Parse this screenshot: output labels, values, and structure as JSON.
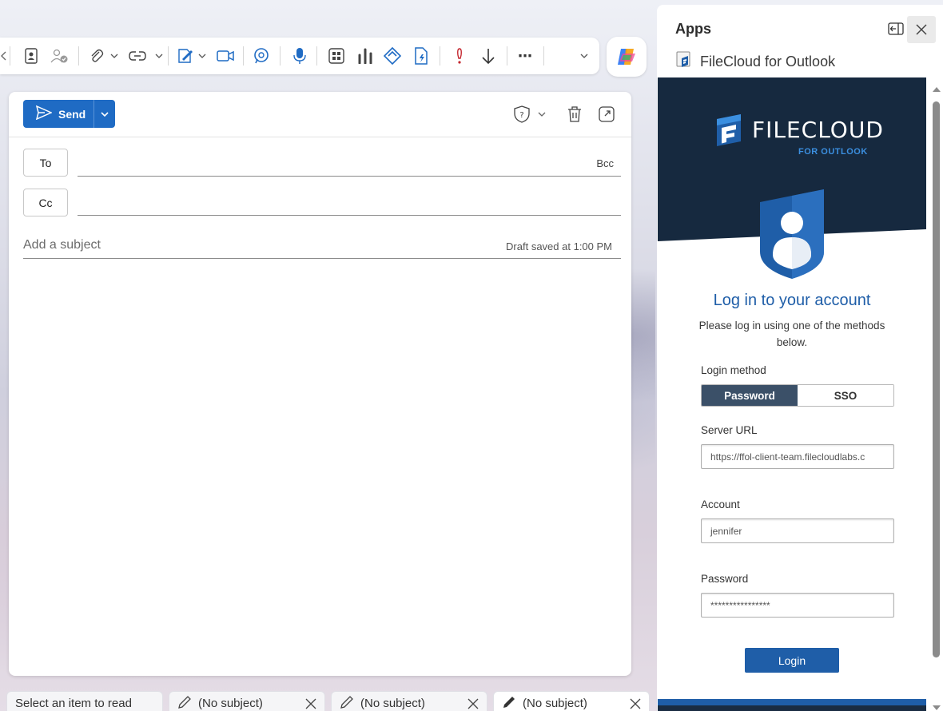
{
  "toolbar": {
    "icons": [
      "contact-card-icon",
      "people-check-icon",
      "attach-icon",
      "link-icon",
      "signature-icon",
      "video-meeting-icon",
      "loop-icon",
      "dictate-icon",
      "apps-grid-icon",
      "chart-icon",
      "viva-icon",
      "editor-icon",
      "importance-high-icon",
      "importance-low-icon",
      "more-icon"
    ],
    "more_label": "⋯"
  },
  "compose": {
    "send_label": "Send",
    "to_label": "To",
    "cc_label": "Cc",
    "bcc_label": "Bcc",
    "subject_placeholder": "Add a subject",
    "draft_status": "Draft saved at 1:00 PM"
  },
  "bottom_tabs": [
    {
      "label": "Select an item to read"
    },
    {
      "label": "(No subject)"
    },
    {
      "label": "(No subject)"
    },
    {
      "label": "(No subject)"
    }
  ],
  "panel": {
    "title": "Apps",
    "addin_name": "FileCloud for Outlook",
    "brand_word": "FILECLOUD",
    "brand_sub": "FOR OUTLOOK",
    "login_title": "Log in to your account",
    "login_desc": "Please log in using one of the methods below.",
    "login_method_label": "Login method",
    "method_password": "Password",
    "method_sso": "SSO",
    "selected_method": "Password",
    "server_url_label": "Server URL",
    "server_url_value": "https://ffol-client-team.filecloudlabs.c",
    "account_label": "Account",
    "account_value": "jennifer",
    "password_label": "Password",
    "password_value": "****************",
    "login_button": "Login"
  },
  "colors": {
    "send_blue": "#1f6bc4",
    "hero_navy": "#16293f",
    "accent_blue": "#1f5ea8",
    "segment_selected": "#3b5068"
  }
}
